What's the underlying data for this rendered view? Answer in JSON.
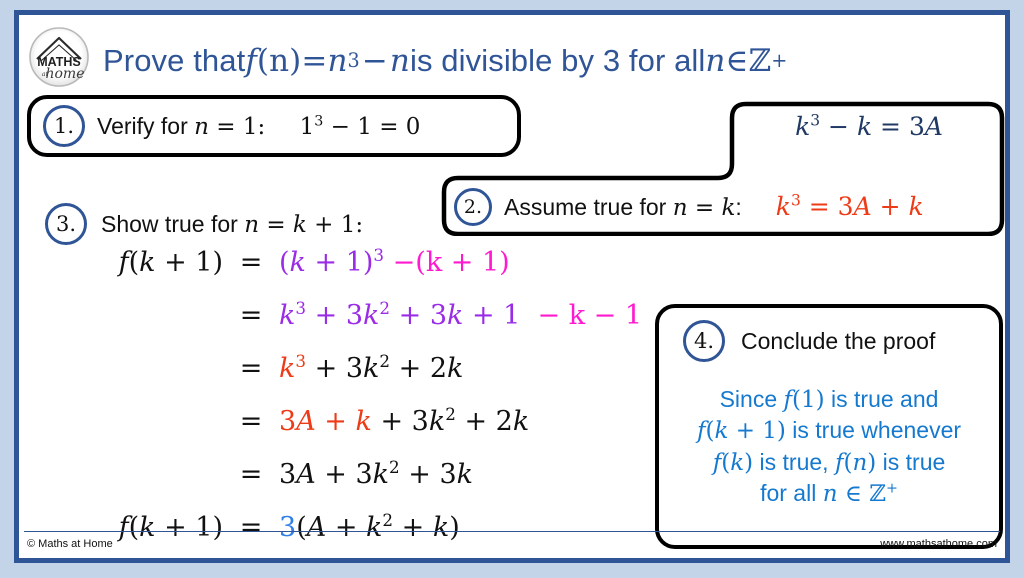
{
  "colors": {
    "frame": "#2f5597",
    "canvas_surround": "#c3d3e8",
    "title": "#2f5597",
    "purple": "#9a2ce6",
    "magenta": "#ff19cf",
    "red": "#ee3b17",
    "blue": "#2e7fe8",
    "navy": "#1f3864",
    "conclusion_blue": "#1579cf"
  },
  "logo": {
    "brand_top": "MATHS",
    "brand_small": "at",
    "brand_script": "home"
  },
  "title": {
    "full_text": "Prove that f(n) = n³ − n is divisible by 3 for all n ∈ ℤ⁺",
    "lead": "Prove that ",
    "f": "f",
    "open": "(n)",
    "eq": " = ",
    "n_base": "n",
    "n_exp": "3",
    "minus": " − ",
    "n2": "n",
    "tail": " is divisible by 3 for all ",
    "n3": "n",
    "in": " ∈ ",
    "z": "ℤ",
    "z_exp": "+"
  },
  "steps": {
    "one": {
      "number": "1.",
      "label": "Verify for",
      "condition_var": "n",
      "condition_eq": " = 1:",
      "equation_text": "1³ − 1 = 0",
      "eq_base": "1",
      "eq_exp": "3",
      "eq_rest": " − 1  =  0"
    },
    "two": {
      "number": "2.",
      "label": "Assume true for",
      "condition_var": "n",
      "condition_eq": " = ",
      "condition_k": "k",
      "condition_colon": ":",
      "top_equation_text": "k³ − k = 3A",
      "top_k": "k",
      "top_exp": "3",
      "top_rest": " − ",
      "top_k2": "k",
      "top_eq": " = 3",
      "top_A": "A",
      "red_equation_text": "k³ = 3A + k",
      "red_k": "k",
      "red_exp": "3",
      "red_eq": " = 3",
      "red_A": "A",
      "red_plus": " + ",
      "red_k2": "k"
    },
    "three": {
      "number": "3.",
      "label": "Show true for",
      "condition_var": "n",
      "condition_eq": " = ",
      "condition_k": "k",
      "condition_tail": " + 1:"
    },
    "four": {
      "number": "4.",
      "label": "Conclude the proof",
      "conclusion_lines": [
        "Since f(1) is true and",
        "f(k + 1) is true whenever",
        "f(k) is true, f(n) is true",
        "for all n ∈ ℤ⁺"
      ]
    }
  },
  "derivation": {
    "rows": [
      {
        "lhs_text": "f(k + 1)",
        "eq": "=",
        "rhs_text": "(k + 1)³ −(k + 1)"
      },
      {
        "lhs_text": "",
        "eq": "=",
        "rhs_text": "k³ + 3k² + 3k + 1 − k − 1"
      },
      {
        "lhs_text": "",
        "eq": "=",
        "rhs_text": "k³ + 3k² + 2k"
      },
      {
        "lhs_text": "",
        "eq": "=",
        "rhs_text": "3A + k + 3k² + 2k"
      },
      {
        "lhs_text": "",
        "eq": "=",
        "rhs_text": "3A + 3k² + 3k"
      },
      {
        "lhs_text": "f(k + 1)",
        "eq": "=",
        "rhs_text": "3(A + k² + k)"
      }
    ]
  },
  "footer": {
    "copyright": "© Maths at Home",
    "website": "www.mathsathome.com"
  }
}
